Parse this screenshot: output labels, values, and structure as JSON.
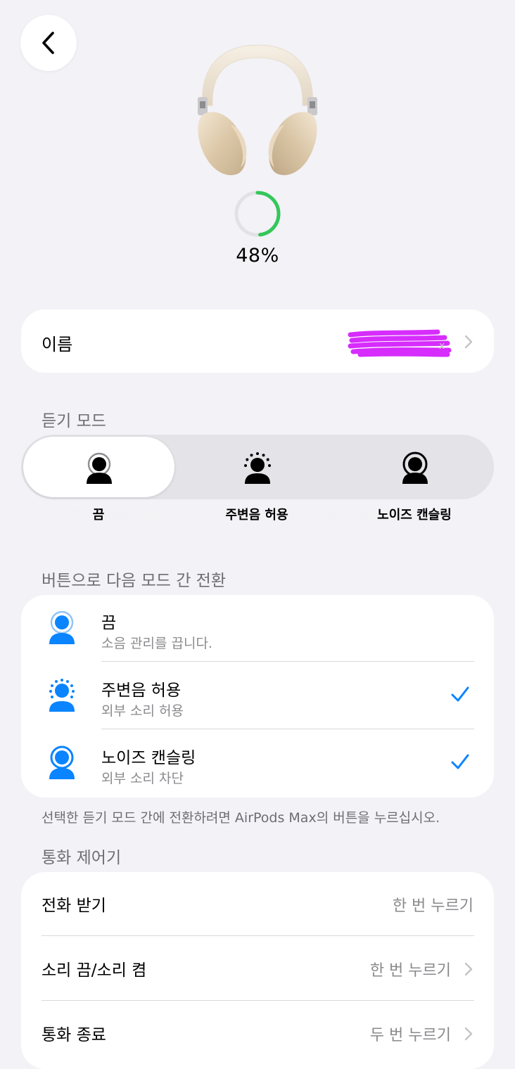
{
  "device": {
    "image": "airpods-max-starlight",
    "battery_percent": 48,
    "battery_label": "48%",
    "battery_color": "#34c759"
  },
  "name_row": {
    "label": "이름",
    "value_redacted": true,
    "redaction_color": "#d62dfc"
  },
  "listening_mode": {
    "section_title": "듣기 모드",
    "selected_index": 0,
    "options": [
      {
        "label": "끔",
        "icon": "person-off-icon"
      },
      {
        "label": "주변음 허용",
        "icon": "person-transparency-icon"
      },
      {
        "label": "노이즈 캔슬링",
        "icon": "person-noise-cancel-icon"
      }
    ]
  },
  "button_switch": {
    "section_title": "버튼으로 다음 모드 간 전환",
    "accent_color": "#0a84ff",
    "items": [
      {
        "title": "끔",
        "subtitle": "소음 관리를 끕니다.",
        "checked": false,
        "icon": "person-off-icon"
      },
      {
        "title": "주변음 허용",
        "subtitle": "외부 소리 허용",
        "checked": true,
        "icon": "person-transparency-icon"
      },
      {
        "title": "노이즈 캔슬링",
        "subtitle": "외부 소리 차단",
        "checked": true,
        "icon": "person-noise-cancel-icon"
      }
    ],
    "footnote": "선택한 듣기 모드 간에 전환하려면 AirPods Max의 버튼을 누르십시오."
  },
  "call_controls": {
    "section_title": "통화 제어기",
    "items": [
      {
        "label": "전화 받기",
        "value": "한 번 누르기",
        "has_chevron": false
      },
      {
        "label": "소리 끔/소리 켬",
        "value": "한 번 누르기",
        "has_chevron": true
      },
      {
        "label": "통화 종료",
        "value": "두 번 누르기",
        "has_chevron": true
      }
    ]
  }
}
